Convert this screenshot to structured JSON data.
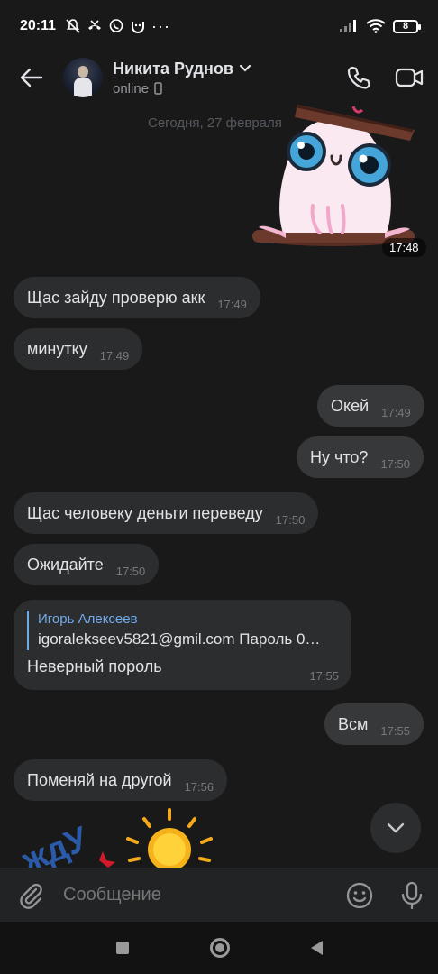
{
  "status_bar": {
    "time": "20:11",
    "battery": "8"
  },
  "header": {
    "contact_name": "Никита Руднов",
    "contact_status": "online"
  },
  "chat": {
    "date_label": "Сегодня, 27 февраля",
    "sticker_time": "17:48",
    "messages": [
      {
        "text": "Щас зайду проверю акк",
        "time": "17:49",
        "direction": "in"
      },
      {
        "text": "минутку",
        "time": "17:49",
        "direction": "in"
      },
      {
        "text": "Окей",
        "time": "17:49",
        "direction": "out"
      },
      {
        "text": "Ну что?",
        "time": "17:50",
        "direction": "out"
      },
      {
        "text": "Щас человеку деньги переведу",
        "time": "17:50",
        "direction": "in"
      },
      {
        "text": "Ожидайте",
        "time": "17:50",
        "direction": "in"
      },
      {
        "text": "Всм",
        "time": "17:55",
        "direction": "out"
      },
      {
        "text": "Поменяй на другой",
        "time": "17:56",
        "direction": "in"
      }
    ],
    "reply_message": {
      "quoted_author": "Игорь Алексеев",
      "quoted_text": "igoralekseev5821@gmil.com Пароль 0…",
      "text": "Неверный пороль",
      "time": "17:55"
    },
    "bottom_sticker_text": "ждУ"
  },
  "composer": {
    "placeholder": "Сообщение"
  },
  "colors": {
    "background": "#19191a",
    "bubble_in": "#2c2d2e",
    "bubble_out": "#37383a",
    "accent": "#71aaeb"
  },
  "icons": {
    "back": "arrow-left-icon",
    "call": "phone-icon",
    "video": "video-camera-icon",
    "attach": "paperclip-icon",
    "emoji": "smiley-icon",
    "mic": "microphone-icon",
    "scroll": "chevron-down-icon"
  }
}
